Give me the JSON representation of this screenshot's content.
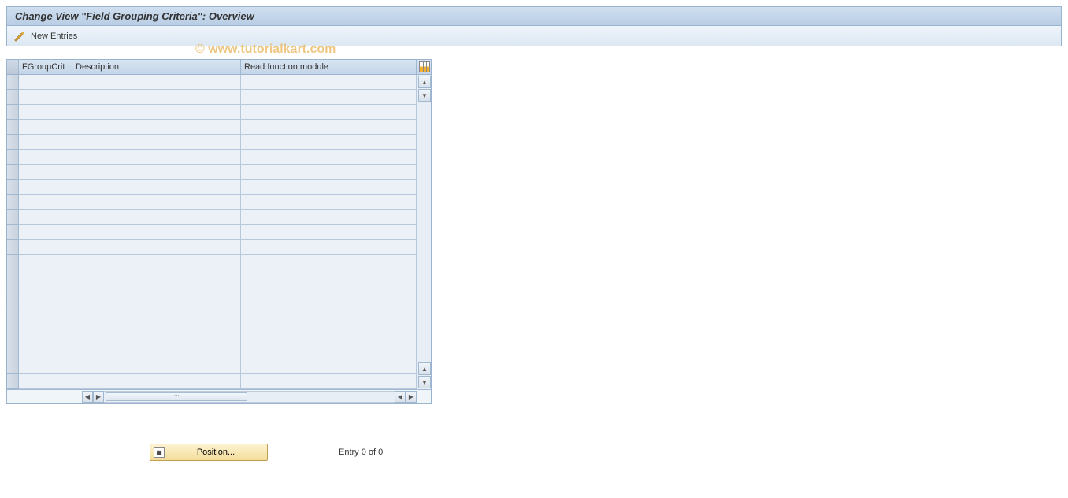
{
  "titleBar": {
    "title": "Change View \"Field Grouping Criteria\": Overview"
  },
  "toolbar": {
    "newEntriesLabel": "New Entries"
  },
  "watermark": "© www.tutorialkart.com",
  "table": {
    "columns": {
      "fgroupCrit": "FGroupCrit",
      "description": "Description",
      "readFnModule": "Read function module"
    },
    "rows": [
      {
        "fgroup": "",
        "desc": "",
        "readfn": ""
      },
      {
        "fgroup": "",
        "desc": "",
        "readfn": ""
      },
      {
        "fgroup": "",
        "desc": "",
        "readfn": ""
      },
      {
        "fgroup": "",
        "desc": "",
        "readfn": ""
      },
      {
        "fgroup": "",
        "desc": "",
        "readfn": ""
      },
      {
        "fgroup": "",
        "desc": "",
        "readfn": ""
      },
      {
        "fgroup": "",
        "desc": "",
        "readfn": ""
      },
      {
        "fgroup": "",
        "desc": "",
        "readfn": ""
      },
      {
        "fgroup": "",
        "desc": "",
        "readfn": ""
      },
      {
        "fgroup": "",
        "desc": "",
        "readfn": ""
      },
      {
        "fgroup": "",
        "desc": "",
        "readfn": ""
      },
      {
        "fgroup": "",
        "desc": "",
        "readfn": ""
      },
      {
        "fgroup": "",
        "desc": "",
        "readfn": ""
      },
      {
        "fgroup": "",
        "desc": "",
        "readfn": ""
      },
      {
        "fgroup": "",
        "desc": "",
        "readfn": ""
      },
      {
        "fgroup": "",
        "desc": "",
        "readfn": ""
      },
      {
        "fgroup": "",
        "desc": "",
        "readfn": ""
      },
      {
        "fgroup": "",
        "desc": "",
        "readfn": ""
      },
      {
        "fgroup": "",
        "desc": "",
        "readfn": ""
      },
      {
        "fgroup": "",
        "desc": "",
        "readfn": ""
      },
      {
        "fgroup": "",
        "desc": "",
        "readfn": ""
      }
    ]
  },
  "bottom": {
    "positionLabel": "Position...",
    "entryStatus": "Entry 0 of 0"
  }
}
